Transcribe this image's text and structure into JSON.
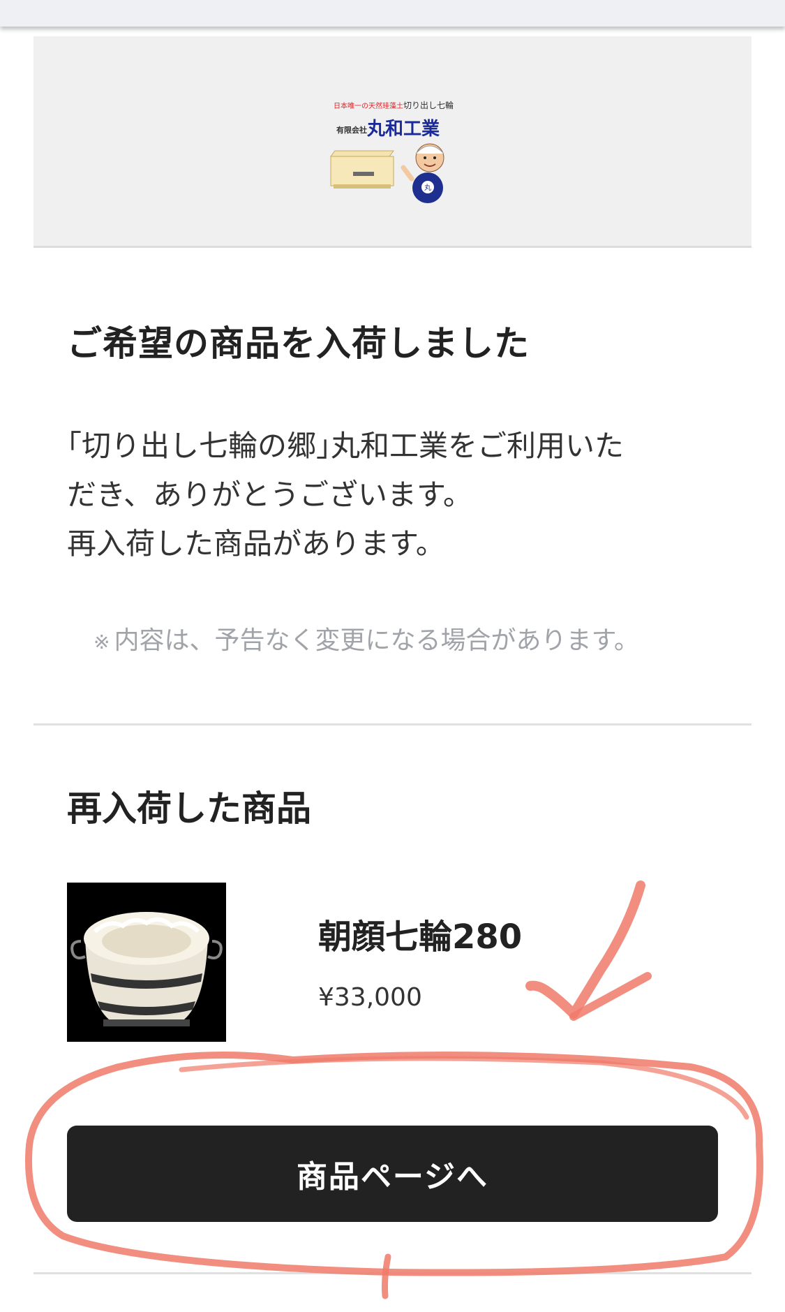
{
  "banner": {
    "tagline_red": "日本唯一の天然珪藻土",
    "tagline": "切り出し七輪",
    "company_prefix": "有限会社",
    "company_name": "丸和工業"
  },
  "main": {
    "heading": "ご希望の商品を入荷しました",
    "intro_lines": [
      "｢切り出し七輪の郷｣丸和工業をご利用いた",
      "だき、ありがとうございます。",
      "再入荷した商品があります。"
    ],
    "notice_mark": "※",
    "notice": "内容は、予告なく変更になる場合があります。"
  },
  "restock": {
    "heading": "再入荷した商品",
    "product": {
      "name": "朝顔七輪280",
      "price": "¥33,000"
    },
    "button_label": "商品ページへ"
  },
  "colors": {
    "button_bg": "#222222",
    "annotation": "#f07a6a",
    "banner_bg": "#f0f0f0"
  }
}
